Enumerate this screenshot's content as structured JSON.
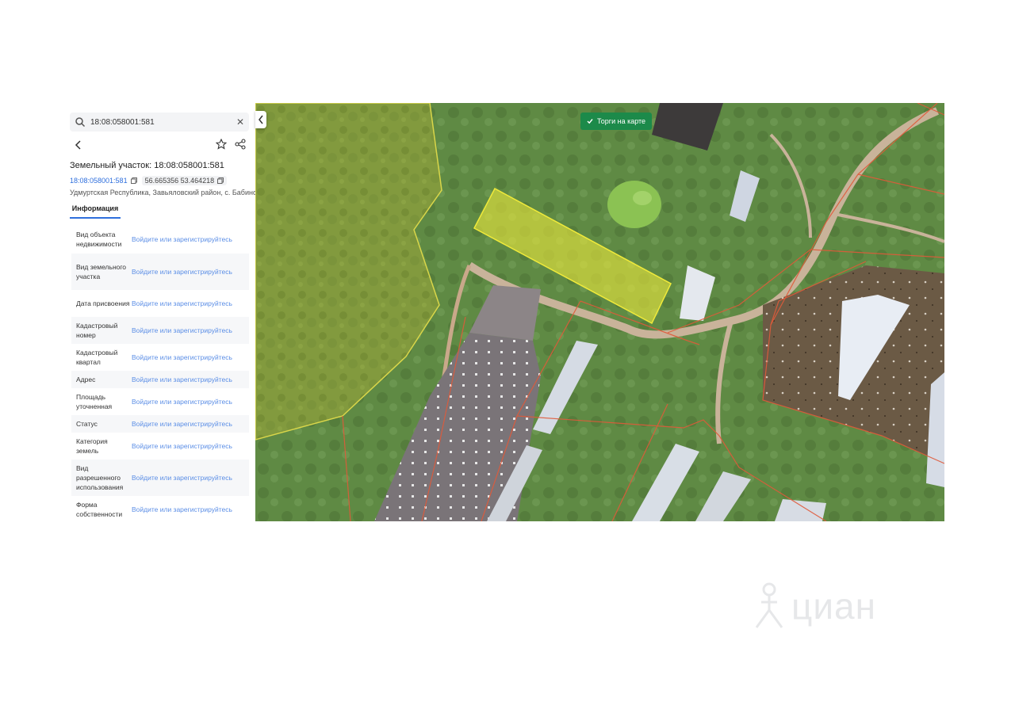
{
  "search": {
    "value": "18:08:058001:581",
    "icon": "search-icon",
    "clear_icon": "close-icon"
  },
  "header": {
    "back_icon": "chevron-left-icon",
    "favorite_icon": "star-icon",
    "share_icon": "share-icon"
  },
  "parcel": {
    "title": "Земельный участок: 18:08:058001:581",
    "number": "18:08:058001:581",
    "coordinates": "56.665356 53.464218",
    "address": "Удмуртская Республика, Завьяловский район, с. Бабино"
  },
  "tabs": [
    {
      "label": "Информация",
      "active": true
    }
  ],
  "properties": [
    {
      "label": "Вид объекта недвижимости",
      "value": "Войдите или зарегистрируйтесь"
    },
    {
      "label": "Вид земельного участка",
      "value": "Войдите или зарегистрируйтесь"
    },
    {
      "label": "Дата присвоения",
      "value": "Войдите или зарегистрируйтесь"
    },
    {
      "label": "Кадастровый номер",
      "value": "Войдите или зарегистрируйтесь"
    },
    {
      "label": "Кадастровый квартал",
      "value": "Войдите или зарегистрируйтесь"
    },
    {
      "label": "Адрес",
      "value": "Войдите или зарегистрируйтесь"
    },
    {
      "label": "Площадь уточненная",
      "value": "Войдите или зарегистрируйтесь"
    },
    {
      "label": "Статус",
      "value": "Войдите или зарегистрируйтесь"
    },
    {
      "label": "Категория земель",
      "value": "Войдите или зарегистрируйтесь"
    },
    {
      "label": "Вид разрешенного использования",
      "value": "Войдите или зарегистрируйтесь"
    },
    {
      "label": "Форма собственности",
      "value": "Войдите или зарегистрируйтесь"
    }
  ],
  "map": {
    "torgi_label": "Торги на карте",
    "torgi_color": "#1c8a4a",
    "parcel_highlight": "#e5e23a",
    "boundary_color": "#e0573a"
  },
  "watermark": "циан"
}
